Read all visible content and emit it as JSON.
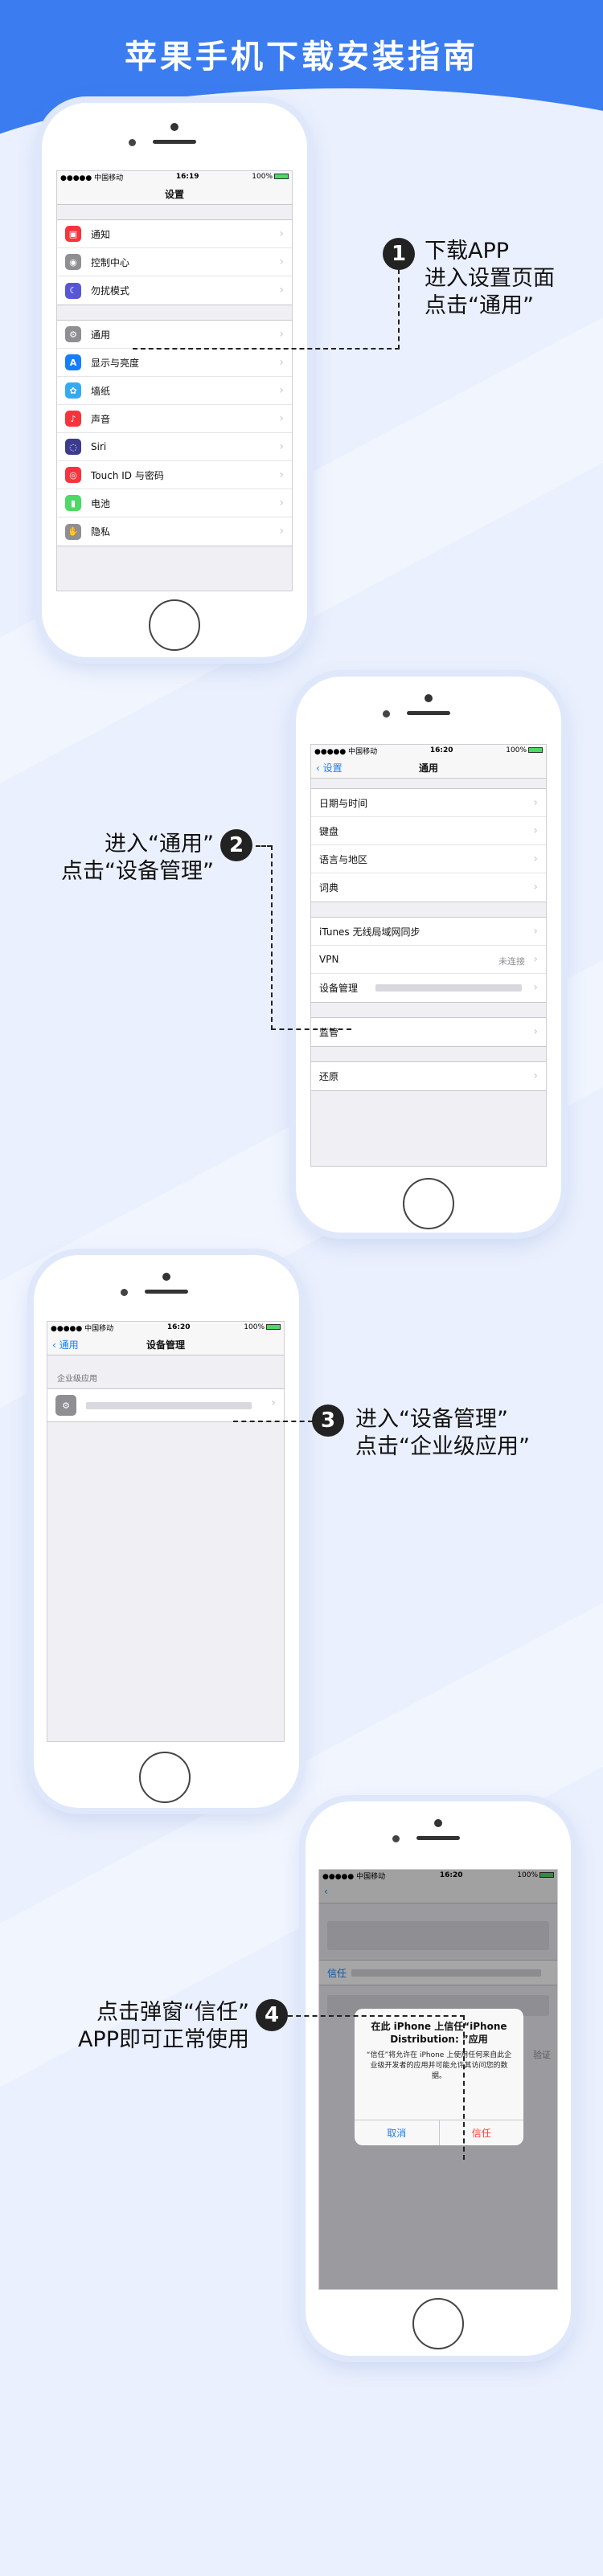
{
  "page_title": "苹果手机下载安装指南",
  "status": {
    "carrier": "●●●●● 中国移动",
    "battery": "100%",
    "time1": "16:19",
    "time2": "16:20"
  },
  "steps": [
    {
      "num": "1",
      "line1": "下载APP",
      "line2": "进入设置页面",
      "line3": "点击“通用”"
    },
    {
      "num": "2",
      "line1": "进入“通用”",
      "line2": "点击“设备管理”"
    },
    {
      "num": "3",
      "line1": "进入“设备管理”",
      "line2": "点击“企业级应用”"
    },
    {
      "num": "4",
      "line1": "点击弹窗“信任”",
      "line2": "APP即可正常使用"
    }
  ],
  "screen1": {
    "title": "设置",
    "group1": [
      "通知",
      "控制中心",
      "勿扰模式"
    ],
    "group2": [
      "通用",
      "显示与亮度",
      "墙纸",
      "声音",
      "Siri",
      "Touch ID 与密码",
      "电池",
      "隐私"
    ]
  },
  "screen2": {
    "back": "设置",
    "title": "通用",
    "group1": [
      "日期与时间",
      "键盘",
      "语言与地区",
      "词典"
    ],
    "group2": [
      "iTunes 无线局域网同步",
      "VPN",
      "设备管理"
    ],
    "vpn_status": "未连接",
    "group3": [
      "监管"
    ],
    "group4": [
      "还原"
    ]
  },
  "screen3": {
    "back": "通用",
    "title": "设备管理",
    "section": "企业级应用"
  },
  "screen4": {
    "dialog_title": "在此 iPhone 上信任“iPhone Distribution: ”应用",
    "dialog_msg": "“信任”将允许在 iPhone 上使用任何来自此企业级开发者的应用并可能允许其访问您的数据。",
    "cancel": "取消",
    "trust": "信任",
    "trust_row": "信任",
    "verify": "验证"
  }
}
